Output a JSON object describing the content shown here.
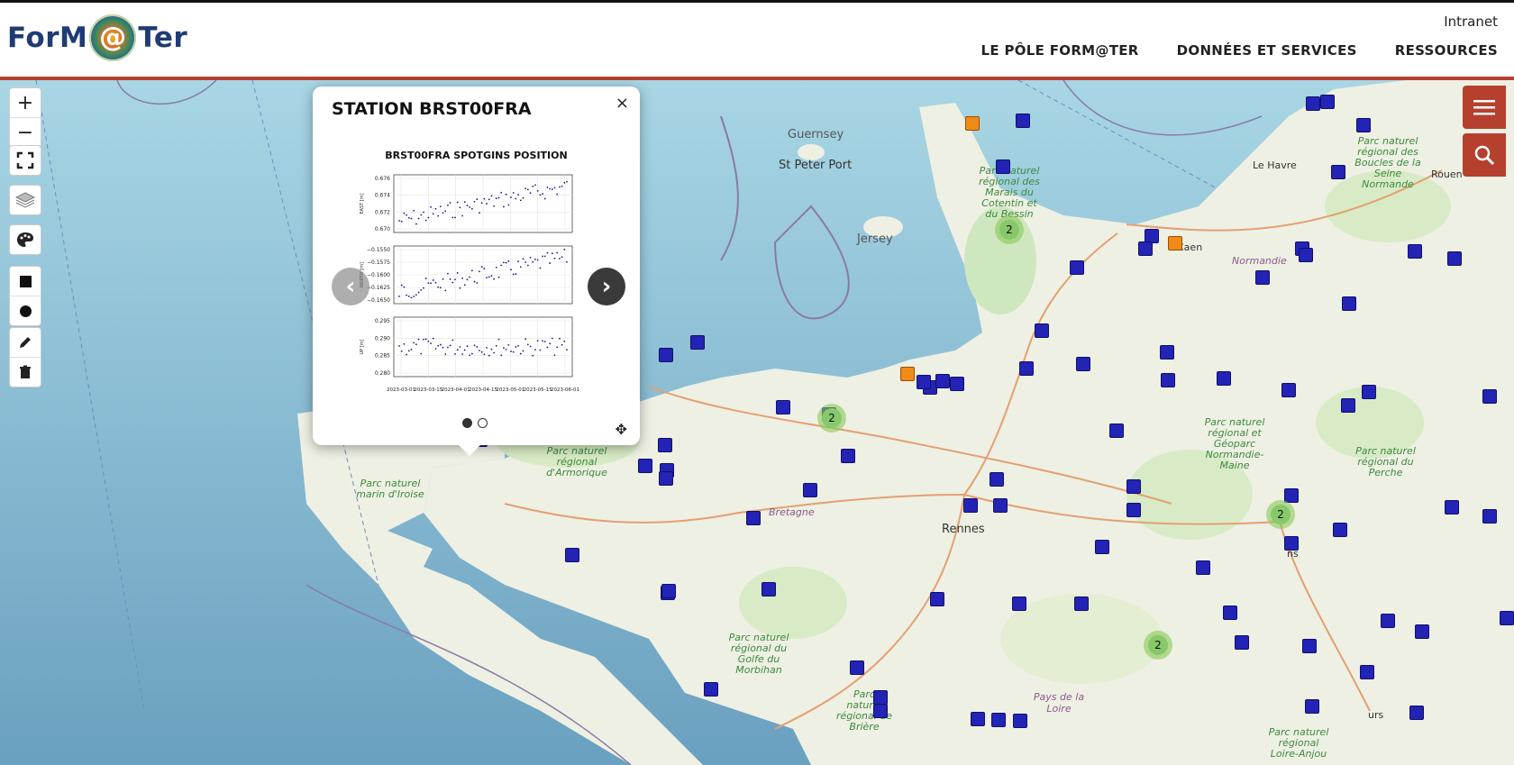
{
  "header": {
    "logo_text_left": "ForM",
    "logo_at": "@",
    "logo_text_right": "Ter",
    "intranet": "Intranet",
    "nav": [
      "LE PÔLE FORM@TER",
      "DONNÉES ET SERVICES",
      "RESSOURCES"
    ]
  },
  "map_controls": {
    "zoom_in": "+",
    "zoom_out": "−",
    "fullscreen_icon": "fullscreen-icon",
    "layers_icon": "layers-icon",
    "palette_icon": "palette-icon",
    "draw_square_icon": "square-icon",
    "draw_circle_icon": "circle-icon",
    "edit_icon": "pencil-icon",
    "delete_icon": "trash-icon"
  },
  "right_buttons": {
    "menu_icon": "menu-icon",
    "search_icon": "search-icon"
  },
  "popup": {
    "title": "STATION BRST00FRA",
    "close": "×",
    "chart_title": "BRST00FRA SPOTGINS POSITION",
    "move_icon": "move-icon"
  },
  "chart_data": {
    "type": "scatter",
    "title": "BRST00FRA SPOTGINS POSITION",
    "panels": [
      {
        "ylabel": "EAST [m]",
        "yticks": [
          "0.676",
          "0.674",
          "0.672",
          "0.670"
        ],
        "ylim": [
          0.6695,
          0.677
        ]
      },
      {
        "ylabel": "NORTH [m]",
        "yticks": [
          "−0.1550",
          "−0.1575",
          "−0.1600",
          "−0.1625",
          "−0.1650"
        ],
        "ylim": [
          -0.1655,
          -0.1548
        ]
      },
      {
        "ylabel": "UP [m]",
        "yticks": [
          "0.295",
          "0.290",
          "0.285",
          "0.280"
        ],
        "ylim": [
          0.2795,
          0.2985
        ]
      }
    ],
    "xticks": [
      "2023-03-01",
      "2023-03-15",
      "2023-04-01",
      "2023-04-15",
      "2023-05-01",
      "2023-05-15",
      "2023-06-01"
    ]
  },
  "map_labels": {
    "guernsey": "Guernsey",
    "st_peter_port": "St Peter Port",
    "jersey": "Jersey",
    "le_havre": "Le Havre",
    "rouen": "Rouen",
    "caen": "Caen",
    "rennes": "Rennes",
    "bretagne": "Bretagne",
    "normandie": "Normandie",
    "pays_de_la_loire": "Pays de la Loire",
    "mans": "ns",
    "tours": "urs"
  },
  "park_labels": {
    "iroise": "Parc naturel marin d'Iroise",
    "armorique": "Parc naturel régional d'Armorique",
    "cotentin": "Parc naturel régional des Marais du Cotentin et du Bessin",
    "seine": "Parc naturel régional des Boucles de la Seine Normande",
    "normandie_maine": "Parc naturel régional et Géoparc Normandie-Maine",
    "perche": "Parc naturel régional du Perche",
    "morbihan": "Parc naturel régional du Golfe du Morbihan",
    "briere": "Parc naturel régional de Brière",
    "loire_anjou": "Parc naturel régional Loire-Anjou"
  },
  "clusters": [
    "2",
    "2",
    "2",
    "2"
  ],
  "colors": {
    "accent": "#b5402e",
    "station": "#2323b6",
    "station_alt": "#f08a18",
    "cluster": "#86c86a"
  }
}
